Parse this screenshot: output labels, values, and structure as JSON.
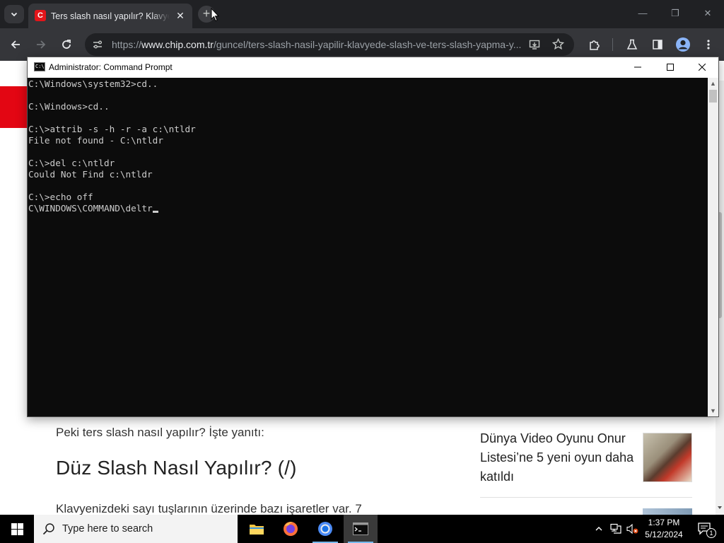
{
  "browser": {
    "tab": {
      "title": "Ters slash nasıl yapılır? Klavyede slash ve ters slash yapma yöntemleri"
    },
    "url_scheme": "https://",
    "url_host": "www.chip.com.tr",
    "url_path": "/guncel/ters-slash-nasil-yapilir-klavyede-slash-ve-ters-slash-yapma-y..."
  },
  "page": {
    "lead": "Peki ters slash nasıl yapılır? İşte yanıtı:",
    "heading": "Düz Slash Nasıl Yapılır? (/)",
    "body": "Klavyenizdeki sayı tuşlarının üzerinde bazı işaretler var. 7",
    "sidebar_card": "Dünya Video Oyunu Onur Listesi’ne 5 yeni oyun daha katıldı"
  },
  "cmd": {
    "title": "Administrator: Command Prompt",
    "lines": [
      "C:\\Windows\\system32>cd..",
      "",
      "C:\\Windows>cd..",
      "",
      "C:\\>attrib -s -h -r -a c:\\ntldr",
      "File not found - C:\\ntldr",
      "",
      "C:\\>del c:\\ntldr",
      "Could Not Find c:\\ntldr",
      "",
      "C:\\>echo off",
      "C\\WINDOWS\\COMMAND\\deltr"
    ]
  },
  "taskbar": {
    "search_placeholder": "Type here to search",
    "time": "1:37 PM",
    "date": "5/12/2024",
    "notification_count": "1"
  },
  "colors": {
    "chrome_dark": "#202124",
    "chrome_toolbar": "#35363a",
    "chip_red": "#e30613",
    "cmd_bg": "#0c0c0c",
    "cmd_text": "#cccccc"
  }
}
